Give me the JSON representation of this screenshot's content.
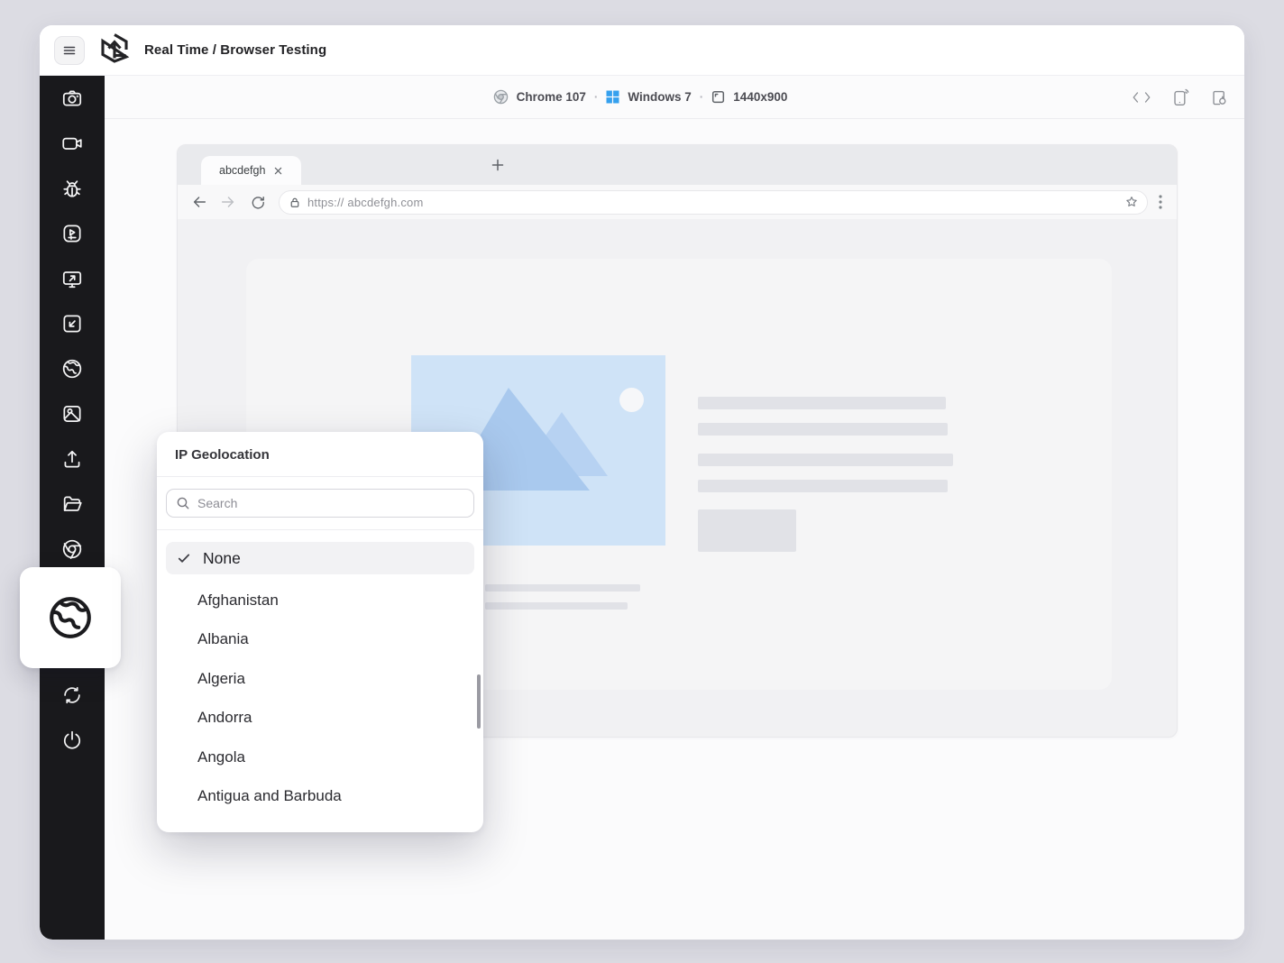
{
  "header": {
    "title": "Real Time / Browser Testing"
  },
  "toolbar": {
    "browser": "Chrome 107",
    "os": "Windows 7",
    "resolution": "1440x900",
    "separator": "·",
    "right_icons": [
      "code-icon",
      "device-info-icon",
      "session-report-icon"
    ]
  },
  "sidebar": {
    "icons": [
      "screenshot-camera-icon",
      "record-video-icon",
      "report-bug-icon",
      "session-player-icon",
      "switch-resolution-icon",
      "open-external-icon",
      "geolocation-globe-icon",
      "gallery-location-icon",
      "upload-icon",
      "files-folder-icon",
      "switch-browser-chrome-icon",
      "switch-session-icon",
      "end-session-power-icon"
    ],
    "active_item": "ip-geolocation"
  },
  "browser_mock": {
    "tab_title": "abcdefgh",
    "url": "https:// abcdefgh.com"
  },
  "geo_panel": {
    "title": "IP Geolocation",
    "search_placeholder": "Search",
    "selected": "None",
    "countries": [
      "Afghanistan",
      "Albania",
      "Algeria",
      "Andorra",
      "Angola",
      "Antigua and Barbuda"
    ]
  },
  "colors": {
    "page_bg": "#dcdce3",
    "sidebar_bg": "#19191c",
    "windows_blue": "#35a0ee",
    "placeholder_blue": "#cfe3f7",
    "mountain_blue": "#a9c9ee",
    "skeleton_gray": "#e1e2e7"
  }
}
